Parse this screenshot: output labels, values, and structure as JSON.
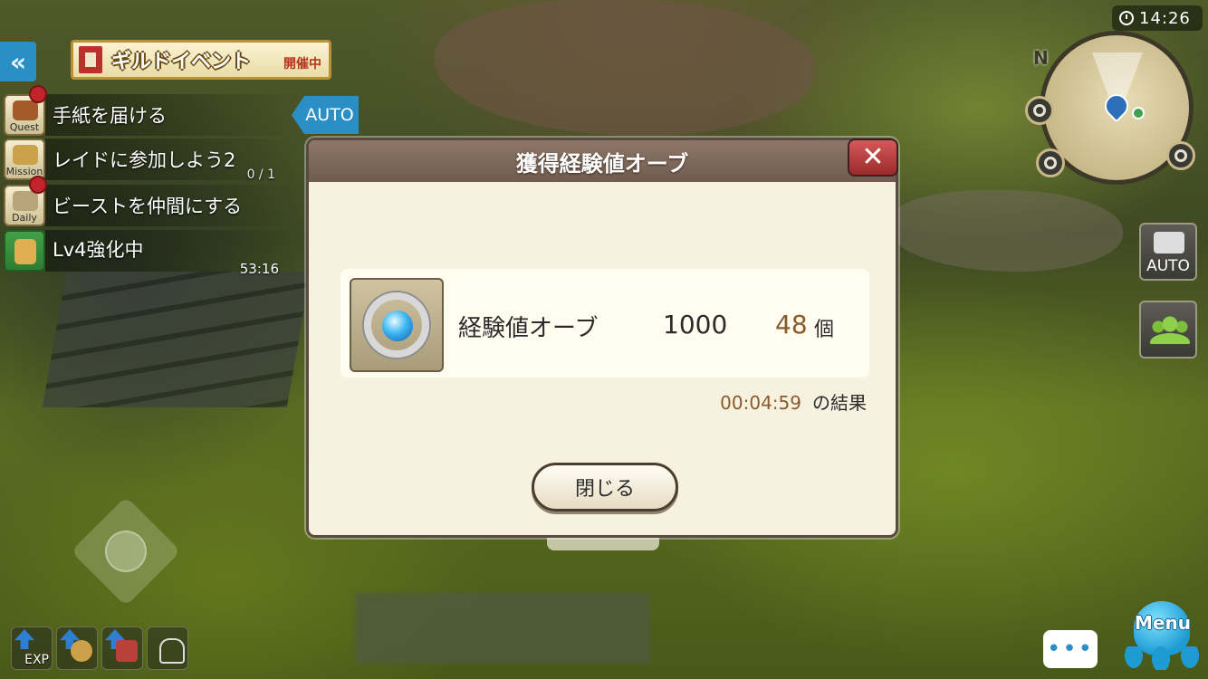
{
  "hud": {
    "guild_event": {
      "title": "ギルドイベント",
      "status": "開催中"
    },
    "auto_label": "AUTO",
    "quests": [
      {
        "icon_label": "Quest",
        "text": "手紙を届ける",
        "sub": ""
      },
      {
        "icon_label": "Mission",
        "text": "レイドに参加しよう2",
        "sub": "0 / 1"
      },
      {
        "icon_label": "Daily",
        "text": "ビーストを仲間にする",
        "sub": ""
      },
      {
        "icon_label": "",
        "text": "Lv4強化中",
        "sub": "53:16"
      }
    ],
    "buffs": [
      "EXP",
      "",
      "",
      ""
    ],
    "clock": "14:26",
    "map_north": "N",
    "camera_auto_label": "AUTO",
    "chat_glyph": "•••",
    "menu_label": "Menu"
  },
  "dialog": {
    "title": "獲得経験値オーブ",
    "close_glyph": "✕",
    "item": {
      "name": "経験値オーブ",
      "value": "1000",
      "count": "48",
      "unit": "個"
    },
    "result_time": "00:04:59",
    "result_label": "の結果",
    "close_button": "閉じる"
  },
  "colors": {
    "accent": "#2a8fc4",
    "dialog_bg": "#f7f2df",
    "header": "#7e685b",
    "count": "#8a5a2a",
    "close": "#c04040"
  }
}
